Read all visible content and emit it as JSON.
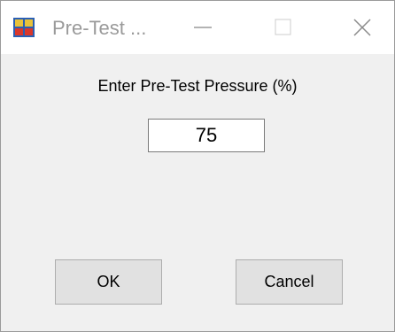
{
  "window": {
    "title": "Pre-Test ..."
  },
  "dialog": {
    "prompt": "Enter Pre-Test Pressure (%)",
    "pressure_value": "75"
  },
  "buttons": {
    "ok_label": "OK",
    "cancel_label": "Cancel"
  },
  "icons": {
    "app": "app-icon",
    "minimize": "minimize-icon",
    "maximize": "maximize-icon",
    "close": "close-icon"
  },
  "colors": {
    "titlebar": "#ffffff",
    "body": "#f0f0f0",
    "title_text": "#9a9a9a",
    "button_face": "#e1e1e1"
  }
}
